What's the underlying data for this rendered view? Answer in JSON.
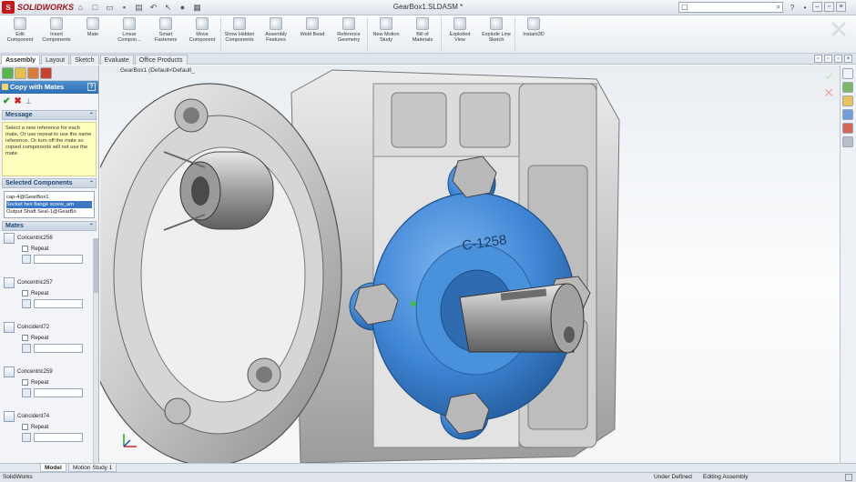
{
  "app": {
    "logo_text": "SOLIDWORKS",
    "doc_title": "GearBox1.SLDASM *"
  },
  "search": {
    "placeholder": ""
  },
  "ribbon": {
    "commands": [
      {
        "label": "Edit Component"
      },
      {
        "label": "Insert Components"
      },
      {
        "label": "Mate"
      },
      {
        "label": "Linear Compon..."
      },
      {
        "label": "Smart Fasteners"
      },
      {
        "label": "Move Component"
      },
      {
        "label": "Show Hidden Components"
      },
      {
        "label": "Assembly Features"
      },
      {
        "label": "Weld Bead"
      },
      {
        "label": "Reference Geometry"
      },
      {
        "label": "New Motion Study"
      },
      {
        "label": "Bill of Materials"
      },
      {
        "label": "Exploded View"
      },
      {
        "label": "Explode Line Sketch"
      },
      {
        "label": "Instant3D"
      }
    ]
  },
  "tabs": [
    "Assembly",
    "Layout",
    "Sketch",
    "Evaluate",
    "Office Products"
  ],
  "property_manager": {
    "title": "Copy with Mates",
    "message_header": "Message",
    "message_text": "Select a new reference for each mate. Or use repeat to use the same reference. Or turn off the mate so copied components will not use the mate.",
    "selected_header": "Selected Components",
    "selected_items": [
      "cap-4@GearBox1",
      "Socket hex flange screw_am",
      "Output Shaft Seal-1@GearBo"
    ],
    "mates_header": "Mates",
    "mates": [
      {
        "name": "Concentric256",
        "repeat": "Repeat"
      },
      {
        "name": "Concentric257",
        "repeat": "Repeat"
      },
      {
        "name": "Coincident72",
        "repeat": "Repeat"
      },
      {
        "name": "Concentric259",
        "repeat": "Repeat"
      },
      {
        "name": "Coincident74",
        "repeat": "Repeat"
      }
    ]
  },
  "viewport": {
    "breadcrumb": "GearBox1 (Default<Default_",
    "cover_label": "C-1258"
  },
  "bottom_tabs": [
    "Model",
    "Motion Study 1"
  ],
  "status": {
    "app": "SolidWorks",
    "state": "Under Defined",
    "mode": "Editing Assembly"
  },
  "colors": {
    "selection_blue": "#3f86d6",
    "accent_red": "#c4161c"
  }
}
